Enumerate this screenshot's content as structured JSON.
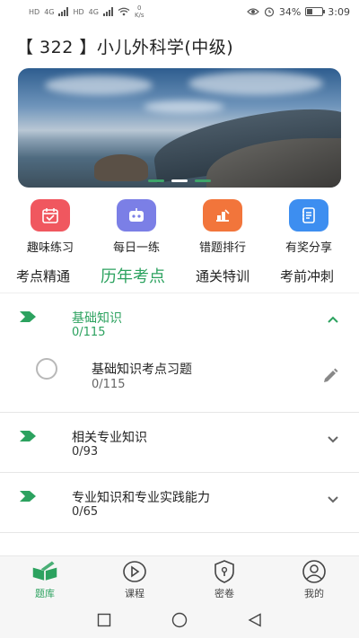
{
  "status_bar": {
    "left_tags": [
      "HD",
      "4G",
      "HD",
      "4G"
    ],
    "net_speed_value": "0",
    "net_speed_unit": "K/s",
    "battery": "34%",
    "time": "3:09"
  },
  "page_title": "【 322 】小儿外科学(中级)",
  "banner": {
    "slide_count": 3,
    "active_slide": 1
  },
  "quick_entries": [
    {
      "label": "趣味练习",
      "icon": "calendar-icon",
      "color": "#f0575f"
    },
    {
      "label": "每日一练",
      "icon": "robot-icon",
      "color": "#7b7fe6"
    },
    {
      "label": "错题排行",
      "icon": "ranking-icon",
      "color": "#f2753b"
    },
    {
      "label": "有奖分享",
      "icon": "notebook-icon",
      "color": "#3d8ef0"
    }
  ],
  "tabs": [
    {
      "label": "考点精通",
      "active": false
    },
    {
      "label": "历年考点",
      "active": true
    },
    {
      "label": "通关特训",
      "active": false
    },
    {
      "label": "考前冲刺",
      "active": false
    }
  ],
  "sections": [
    {
      "title": "基础知识",
      "count": "0/115",
      "expanded": true,
      "items": [
        {
          "title": "基础知识考点习题",
          "count": "0/115"
        }
      ]
    },
    {
      "title": "相关专业知识",
      "count": "0/93",
      "expanded": false,
      "items": []
    },
    {
      "title": "专业知识和专业实践能力",
      "count": "0/65",
      "expanded": false,
      "items": []
    }
  ],
  "bottom_nav": [
    {
      "label": "题库",
      "icon": "book-icon",
      "active": true
    },
    {
      "label": "课程",
      "icon": "play-icon",
      "active": false
    },
    {
      "label": "密卷",
      "icon": "lock-shield-icon",
      "active": false
    },
    {
      "label": "我的",
      "icon": "user-icon",
      "active": false
    }
  ],
  "colors": {
    "accent": "#2ca25f",
    "text": "#222222",
    "divider": "#e6e6e6"
  }
}
